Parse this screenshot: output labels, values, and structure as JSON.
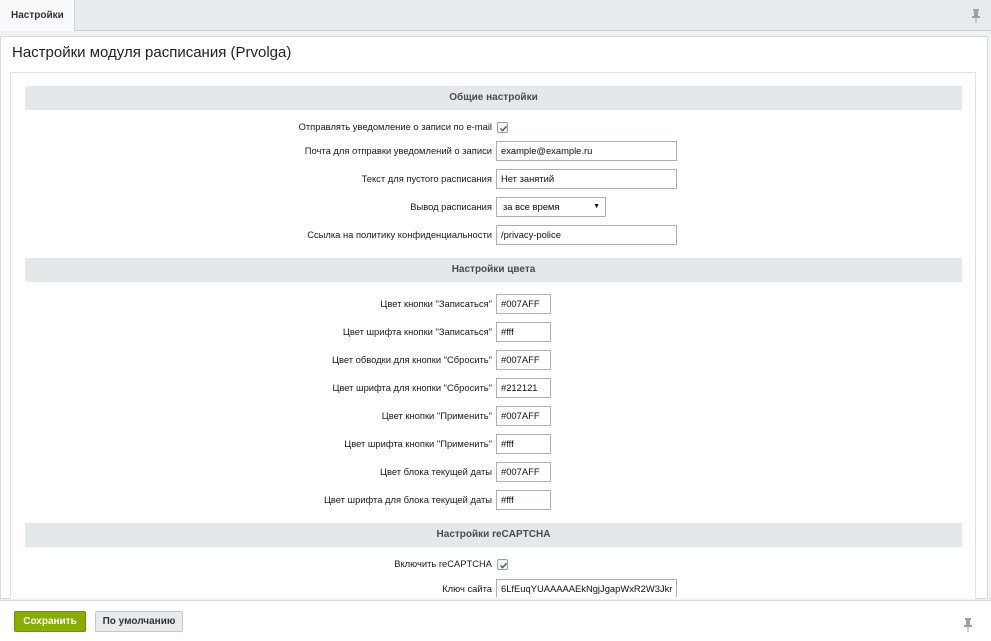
{
  "tab": {
    "label": "Настройки"
  },
  "page": {
    "title": "Настройки модуля расписания (Prvolga)"
  },
  "sections": {
    "general": {
      "title": "Общие настройки",
      "email_notify": {
        "label": "Отправлять уведомление о записи по e-mail",
        "checked": true
      },
      "notify_email": {
        "label": "Почта для отправки уведомлений о записи",
        "value": "example@example.ru"
      },
      "empty_text": {
        "label": "Текст для пустого расписания",
        "value": "Нет занятий"
      },
      "output": {
        "label": "Вывод расписания",
        "value": "за все время"
      },
      "privacy_link": {
        "label": "Ссылка на политику конфиденциальности",
        "value": "/privacy-police"
      }
    },
    "colors": {
      "title": "Настройки цвета",
      "fields": [
        {
          "label": "Цвет кнопки \"Записаться\"",
          "value": "#007AFF"
        },
        {
          "label": "Цвет шрифта кнопки \"Записаться\"",
          "value": "#fff"
        },
        {
          "label": "Цвет обводки для кнопки \"Сбросить\"",
          "value": "#007AFF"
        },
        {
          "label": "Цвет шрифта для кнопки \"Сбросить\"",
          "value": "#212121"
        },
        {
          "label": "Цвет кнопки \"Применить\"",
          "value": "#007AFF"
        },
        {
          "label": "Цвет шрифта кнопки \"Применить\"",
          "value": "#fff"
        },
        {
          "label": "Цвет блока текущей даты",
          "value": "#007AFF"
        },
        {
          "label": "Цвет шрифта для блока текущей даты",
          "value": "#fff"
        }
      ]
    },
    "recaptcha": {
      "title": "Настройки reCAPTCHA",
      "enable": {
        "label": "Включить reCAPTCHA",
        "checked": true
      },
      "site_key": {
        "label": "Ключ сайта",
        "value": "6LfEuqYUAAAAAEkNgjJgapWxR2W3Jkr"
      }
    }
  },
  "buttons": {
    "save": "Сохранить",
    "default": "По умолчанию"
  },
  "colors": {
    "save_button": "#86ad00",
    "section_bg": "#e3e8ea",
    "page_bg": "#eef2f4"
  }
}
